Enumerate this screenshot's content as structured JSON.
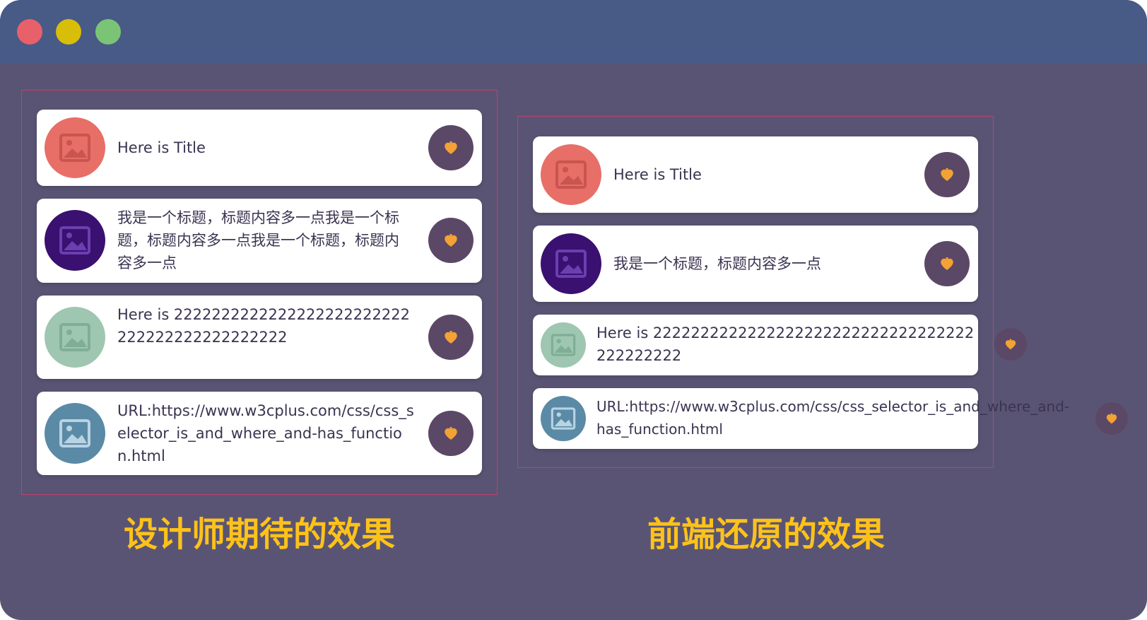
{
  "window": {
    "controls": [
      {
        "name": "close",
        "color": "#e8606a"
      },
      {
        "name": "minimize",
        "color": "#d9be09"
      },
      {
        "name": "maximize",
        "color": "#7cc475"
      }
    ],
    "titlebar_color": "#485a86",
    "background_color": "#5a5474"
  },
  "colors": {
    "panel_border": "#b8436f",
    "caption": "#fdc21a",
    "action_bg": "#5b4866",
    "action_icon": "#f3a234"
  },
  "left_panel": {
    "caption": "设计师期待的效果",
    "cards": [
      {
        "title": "Here is Title",
        "avatar_color": "#e76f67",
        "icon": "image-icon",
        "action_icon": "heart-icon"
      },
      {
        "title": "我是一个标题，标题内容多一点我是一个标题，标题内容多一点我是一个标题，标题内容多一点",
        "avatar_color": "#3a1070",
        "icon": "image-icon",
        "action_icon": "heart-icon"
      },
      {
        "title": "Here is 2222222222222222222222222222222222222222222",
        "avatar_color": "#9ec6b0",
        "icon": "image-icon",
        "action_icon": "heart-icon"
      },
      {
        "title": "URL:https://www.w3cplus.com/css/css_selector_is_and_where_and-has_function.html",
        "avatar_color": "#5b8aa6",
        "icon": "image-icon",
        "action_icon": "heart-icon"
      }
    ]
  },
  "right_panel": {
    "caption": "前端还原的效果",
    "cards": [
      {
        "title": "Here is Title",
        "avatar_color": "#e76f67",
        "icon": "image-icon",
        "action_icon": "heart-icon"
      },
      {
        "title": "我是一个标题，标题内容多一点",
        "avatar_color": "#3a1070",
        "icon": "image-icon",
        "action_icon": "heart-icon"
      },
      {
        "title": "Here is 2222222222222222222222222222222222222222222",
        "avatar_color": "#9ec6b0",
        "icon": "image-icon",
        "action_icon": "heart-icon"
      },
      {
        "title": "URL:https://www.w3cplus.com/css/css_selector_is_and_where_and-has_function.html",
        "avatar_color": "#5b8aa6",
        "icon": "image-icon",
        "action_icon": "heart-icon"
      }
    ]
  }
}
